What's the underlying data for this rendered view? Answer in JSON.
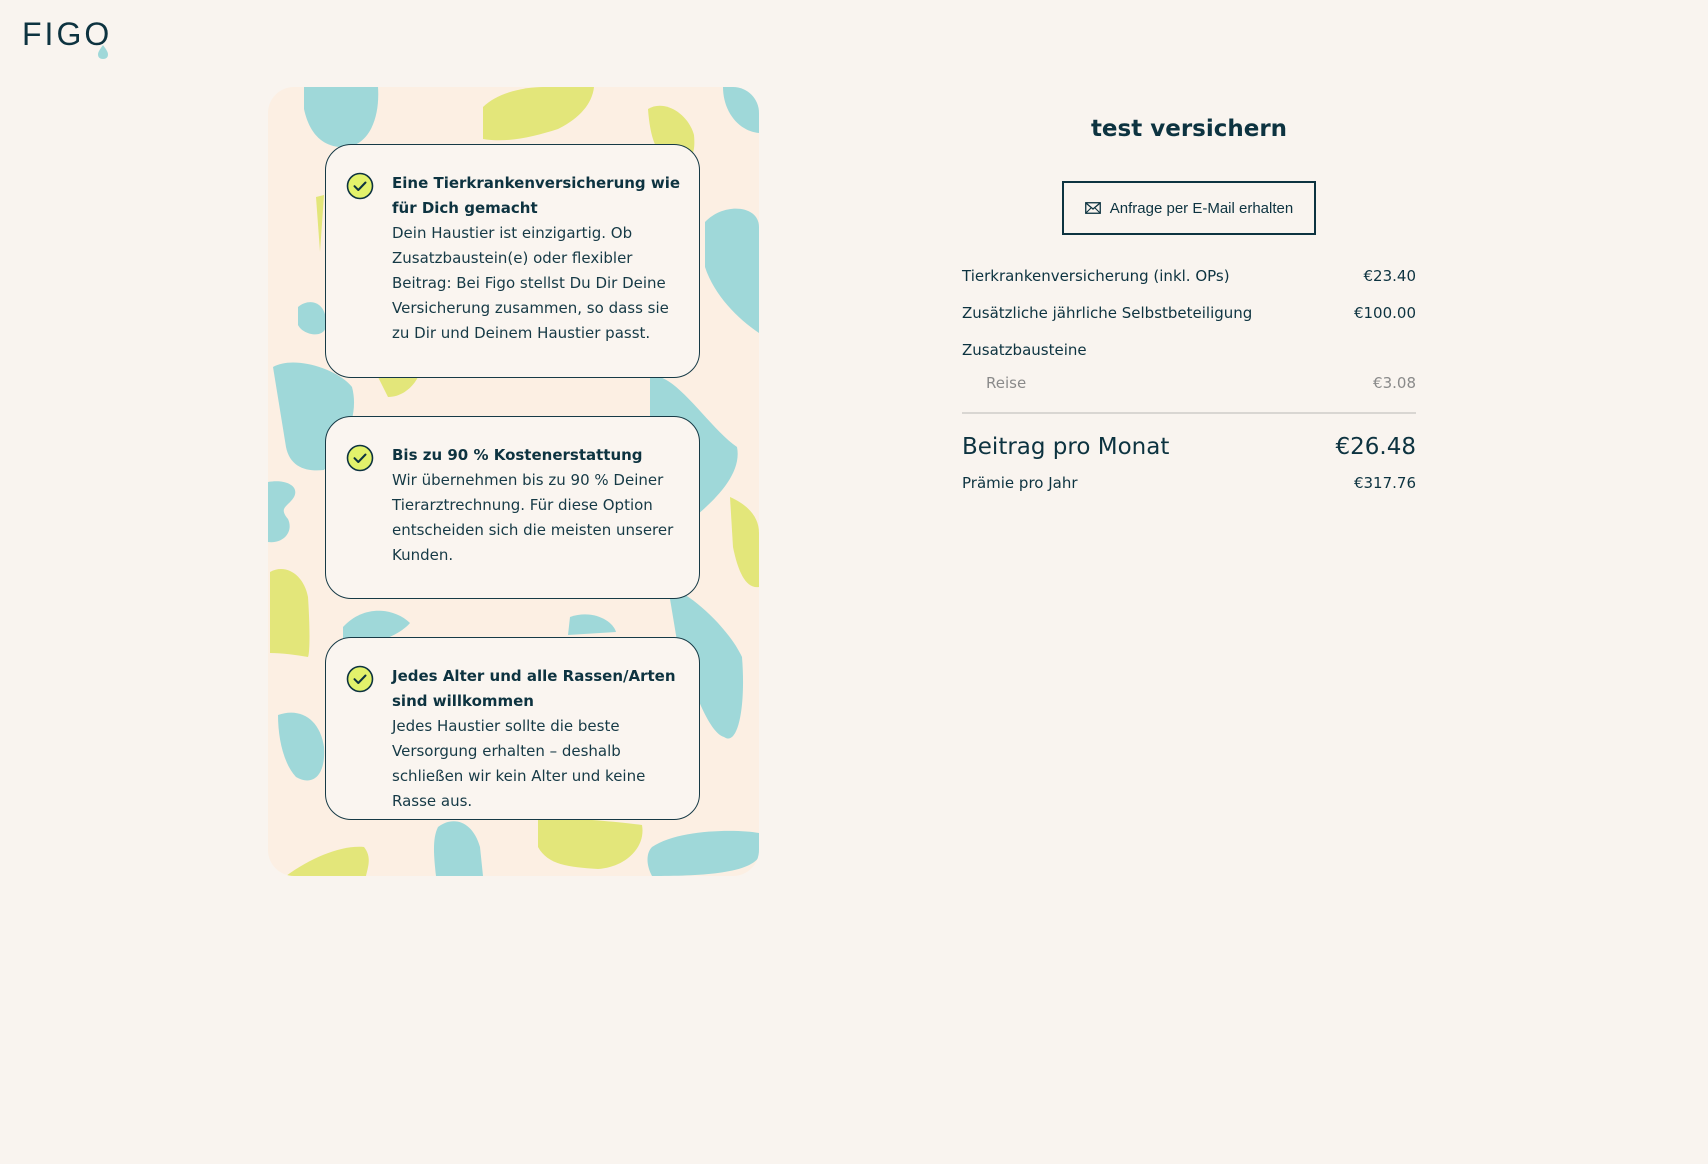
{
  "brand": {
    "logo_text": "FIGO"
  },
  "colors": {
    "background": "#f9f4ef",
    "ink": "#0d3340",
    "teal_shape": "#9fd8d9",
    "lime_shape": "#e3e67a",
    "check_fill": "#e2f26b"
  },
  "features": [
    {
      "icon": "check-circle-icon",
      "title": "Eine Tierkrankenversicherung wie für Dich gemacht",
      "body": "Dein Haustier ist einzigartig. Ob Zusatzbaustein(e) oder flexibler Beitrag: Bei Figo stellst Du Dir Deine Versicherung zusammen, so dass sie zu Dir und Deinem Haustier passt."
    },
    {
      "icon": "check-circle-icon",
      "title": "Bis zu 90 % Kostenerstattung",
      "body": "Wir übernehmen bis zu 90 % Deiner Tierarztrechnung. Für diese Option entscheiden sich die meisten unserer Kunden."
    },
    {
      "icon": "check-circle-icon",
      "title": "Jedes Alter und alle Rassen/Arten sind willkommen",
      "body": "Jedes Haustier sollte die beste Versorgung erhalten – deshalb schließen wir kein Alter und keine Rasse aus."
    }
  ],
  "summary": {
    "title": "test versichern",
    "email_button": {
      "icon": "mail-icon",
      "label": "Anfrage per E-Mail erhalten"
    },
    "lines": [
      {
        "label": "Tierkrankenversicherung (inkl. OPs)",
        "value": "€23.40"
      },
      {
        "label": "Zusätzliche jährliche Selbstbeteiligung",
        "value": "€100.00"
      }
    ],
    "addons_label": "Zusatzbausteine",
    "addons": [
      {
        "label": "Reise",
        "value": "€3.08"
      }
    ],
    "monthly": {
      "label": "Beitrag pro Monat",
      "value": "€26.48"
    },
    "yearly": {
      "label": "Prämie pro Jahr",
      "value": "€317.76"
    }
  }
}
